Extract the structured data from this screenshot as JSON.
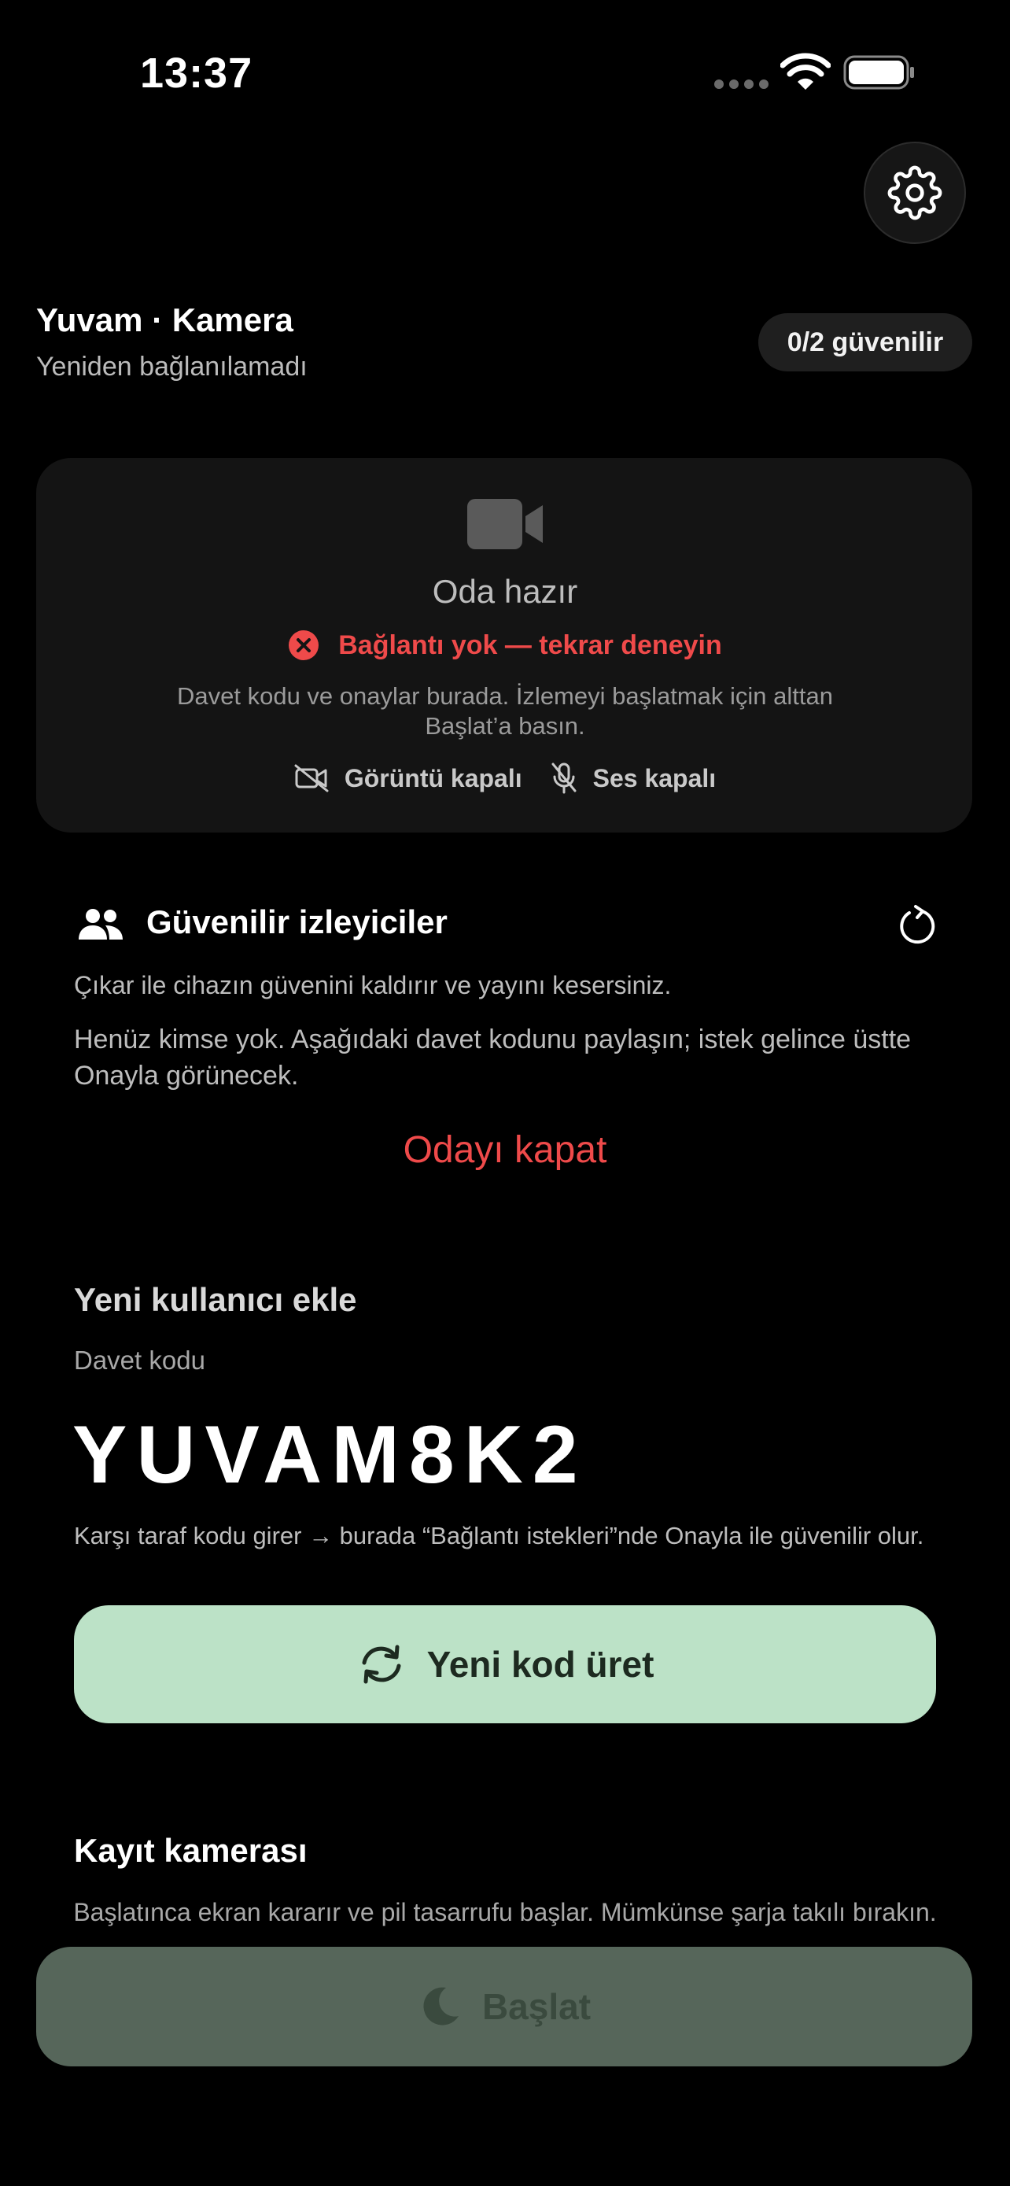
{
  "status_bar": {
    "time": "13:37"
  },
  "header": {
    "device_name": "Yuvam · Kamera",
    "connection_status": "Yeniden bağlanılamadı",
    "trusted_badge": "0/2 güvenilir"
  },
  "preview_card": {
    "title": "Oda hazır",
    "error": "Bağlantı yok — tekrar deneyin",
    "hint": "Davet kodu ve onaylar burada. İzlemeyi başlatmak için alttan Başlat’a basın.",
    "video_status": "Görüntü kapalı",
    "audio_status": "Ses kapalı",
    "error_color": "#ef4a4a"
  },
  "trusted_viewers": {
    "title": "Güvenilir izleyiciler",
    "description": "Çıkar ile cihazın güvenini kaldırır ve yayını kesersiniz.",
    "empty_text": "Henüz kimse yok. Aşağıdaki davet kodunu paylaşın; istek gelince üstte Onayla görünecek.",
    "close_room": "Odayı kapat"
  },
  "add_user": {
    "title": "Yeni kullanıcı ekle",
    "invite_label": "Davet kodu",
    "invite_code": "YUVAM8K2",
    "help": "Karşı taraf kodu girer → burada “Bağlantı istekleri”nde Onayla ile güvenilir olur.",
    "regenerate_button": "Yeni kod üret",
    "button_color": "#bce2c7"
  },
  "record_camera": {
    "title": "Kayıt kamerası",
    "description": "Başlatınca ekran kararır ve pil tasarrufu başlar. Mümkünse şarja takılı bırakın.",
    "start_button": "Başlat"
  },
  "icons": {
    "settings": "gear-icon",
    "camera": "video-camera-icon",
    "error": "error-circle-icon",
    "video_off": "video-off-icon",
    "mic_off": "mic-off-icon",
    "viewers": "people-icon",
    "refresh": "refresh-icon",
    "regenerate": "sync-icon",
    "start": "moon-icon"
  }
}
